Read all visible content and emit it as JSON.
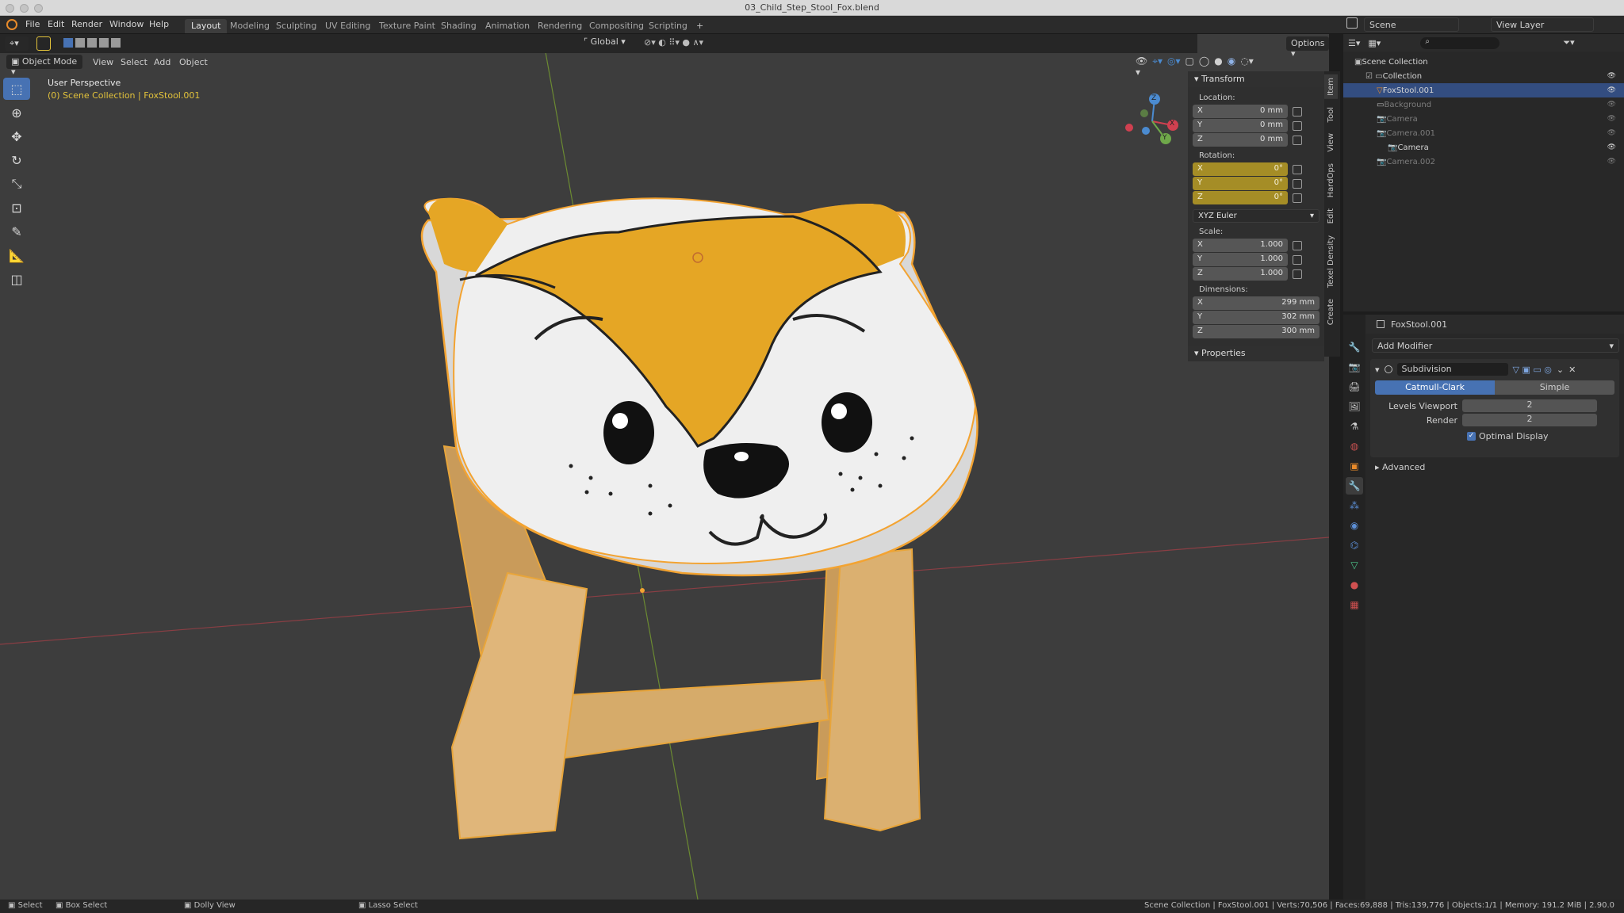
{
  "window": {
    "title": "03_Child_Step_Stool_Fox.blend"
  },
  "menu": [
    "File",
    "Edit",
    "Render",
    "Window",
    "Help"
  ],
  "workspaces": [
    "Layout",
    "Modeling",
    "Sculpting",
    "UV Editing",
    "Texture Paint",
    "Shading",
    "Animation",
    "Rendering",
    "Compositing",
    "Scripting"
  ],
  "workspace_add": "+",
  "scene": {
    "label": "Scene",
    "view_layer": "View Layer"
  },
  "viewport_header": {
    "orientation": "Global",
    "options": "Options",
    "mode": "Object Mode",
    "menus": [
      "View",
      "Select",
      "Add",
      "Object"
    ]
  },
  "viewport_info": {
    "perspective": "User Perspective",
    "collection": "(0) Scene Collection | FoxStool.001"
  },
  "gizmo": {
    "x": "X",
    "y": "Y",
    "z": "Z"
  },
  "npanel": {
    "transform_title": "Transform",
    "location_label": "Location:",
    "location": [
      {
        "axis": "X",
        "value": "0 mm"
      },
      {
        "axis": "Y",
        "value": "0 mm"
      },
      {
        "axis": "Z",
        "value": "0 mm"
      }
    ],
    "rotation_label": "Rotation:",
    "rotation": [
      {
        "axis": "X",
        "value": "0°"
      },
      {
        "axis": "Y",
        "value": "0°"
      },
      {
        "axis": "Z",
        "value": "0°"
      }
    ],
    "rotation_mode": "XYZ Euler",
    "scale_label": "Scale:",
    "scale": [
      {
        "axis": "X",
        "value": "1.000"
      },
      {
        "axis": "Y",
        "value": "1.000"
      },
      {
        "axis": "Z",
        "value": "1.000"
      }
    ],
    "dimensions_label": "Dimensions:",
    "dimensions": [
      {
        "axis": "X",
        "value": "299 mm"
      },
      {
        "axis": "Y",
        "value": "302 mm"
      },
      {
        "axis": "Z",
        "value": "300 mm"
      }
    ],
    "properties_title": "Properties"
  },
  "npanel_tabs": [
    "Item",
    "Tool",
    "View",
    "HardOps",
    "Edit",
    "Texel Density",
    "Create"
  ],
  "outliner": {
    "rows": [
      {
        "label": "Scene Collection",
        "state": "normal"
      },
      {
        "label": "Collection",
        "state": "normal"
      },
      {
        "label": "FoxStool.001",
        "state": "selected"
      },
      {
        "label": "Background",
        "state": "dim"
      },
      {
        "label": "Camera",
        "state": "dim"
      },
      {
        "label": "Camera.001",
        "state": "dim"
      },
      {
        "label": "Camera",
        "state": "normal"
      },
      {
        "label": "Camera.002",
        "state": "dim"
      }
    ]
  },
  "properties": {
    "object": "FoxStool.001",
    "add_modifier": "Add Modifier",
    "modifier_name": "Subdivision",
    "mode_a": "Catmull-Clark",
    "mode_b": "Simple",
    "levels_viewport_label": "Levels Viewport",
    "levels_viewport": "2",
    "render_label": "Render",
    "render": "2",
    "optimal_display": "Optimal Display",
    "advanced": "Advanced"
  },
  "statusbar": {
    "select": "Select",
    "box_select": "Box Select",
    "dolly_view": "Dolly View",
    "lasso_select": "Lasso Select",
    "stats": "Scene Collection | FoxStool.001 | Verts:70,506 | Faces:69,888 | Tris:139,776 | Objects:1/1 | Memory: 191.2 MiB | 2.90.0"
  },
  "colors": {
    "accent": "#4772b3",
    "selection": "#f3a331",
    "animated": "#a58d26"
  }
}
